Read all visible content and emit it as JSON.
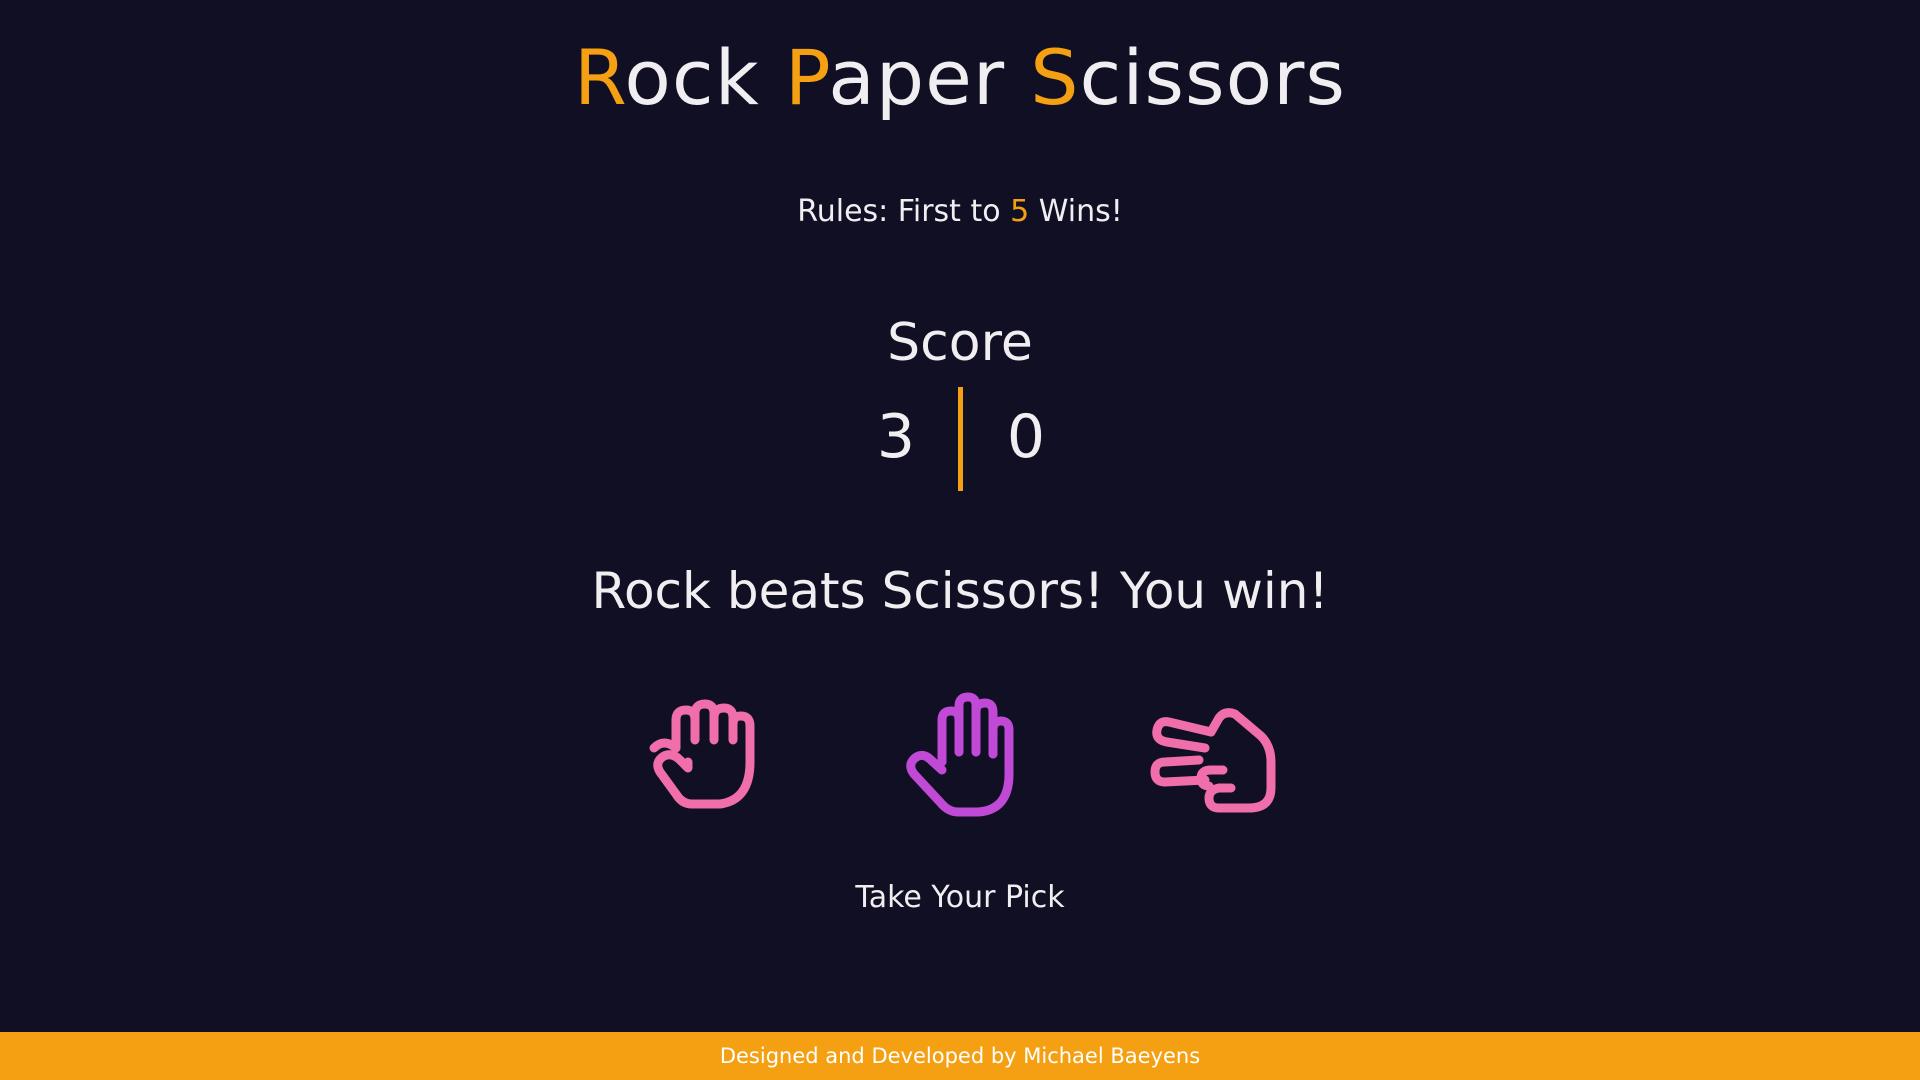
{
  "title": {
    "parts": [
      {
        "accent": "R",
        "rest": "ock "
      },
      {
        "accent": "P",
        "rest": "aper "
      },
      {
        "accent": "S",
        "rest": "cissors"
      }
    ]
  },
  "rules": {
    "prefix": "Rules: First to ",
    "target": "5",
    "suffix": " Wins!"
  },
  "score": {
    "label": "Score",
    "player": "3",
    "computer": "0"
  },
  "message": "Rock beats Scissors! You win!",
  "choices": [
    {
      "name": "rock",
      "icon": "fist-icon",
      "color": "#f06ea9"
    },
    {
      "name": "paper",
      "icon": "open-hand-icon",
      "color": "#c04ad6"
    },
    {
      "name": "scissors",
      "icon": "scissors-hand-icon",
      "color": "#f06ea9"
    }
  ],
  "prompt": "Take Your Pick",
  "footer": "Designed and Developed by Michael Baeyens",
  "colors": {
    "background": "#100f24",
    "accent": "#f5a012",
    "text": "#f0eef0"
  }
}
